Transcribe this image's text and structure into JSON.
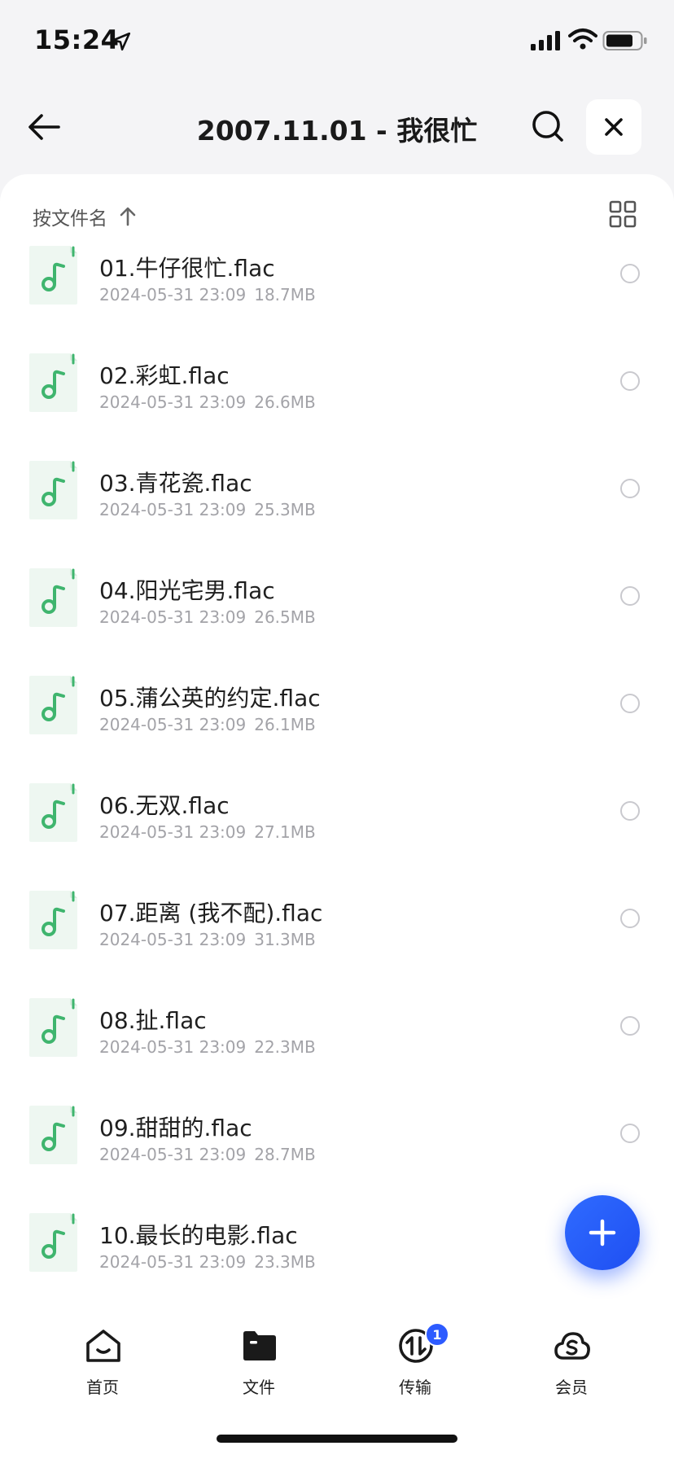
{
  "status_bar": {
    "time": "15:24",
    "icons": [
      "location-arrow-icon",
      "cellular-signal-icon",
      "wifi-icon",
      "battery-icon"
    ]
  },
  "header": {
    "title": "2007.11.01 - 我很忙",
    "back_icon": "arrow-left-icon",
    "search_icon": "search-icon",
    "close_icon": "close-icon"
  },
  "toolbar": {
    "sort_label": "按文件名",
    "sort_icon": "arrow-up-icon",
    "view_icon": "grid-view-icon"
  },
  "files": [
    {
      "name": "01.牛仔很忙.flac",
      "date": "2024-05-31 23:09",
      "size": "18.7MB"
    },
    {
      "name": "02.彩虹.flac",
      "date": "2024-05-31 23:09",
      "size": "26.6MB"
    },
    {
      "name": "03.青花瓷.flac",
      "date": "2024-05-31 23:09",
      "size": "25.3MB"
    },
    {
      "name": "04.阳光宅男.flac",
      "date": "2024-05-31 23:09",
      "size": "26.5MB"
    },
    {
      "name": "05.蒲公英的约定.flac",
      "date": "2024-05-31 23:09",
      "size": "26.1MB"
    },
    {
      "name": "06.无双.flac",
      "date": "2024-05-31 23:09",
      "size": "27.1MB"
    },
    {
      "name": "07.距离 (我不配).flac",
      "date": "2024-05-31 23:09",
      "size": "31.3MB"
    },
    {
      "name": "08.扯.flac",
      "date": "2024-05-31 23:09",
      "size": "22.3MB"
    },
    {
      "name": "09.甜甜的.flac",
      "date": "2024-05-31 23:09",
      "size": "28.7MB"
    },
    {
      "name": "10.最长的电影.flac",
      "date": "2024-05-31 23:09",
      "size": "23.3MB"
    }
  ],
  "fab": {
    "icon": "plus-icon"
  },
  "bottom_nav": {
    "items": [
      {
        "label": "首页",
        "icon": "home-icon"
      },
      {
        "label": "文件",
        "icon": "folder-icon"
      },
      {
        "label": "传输",
        "icon": "transfer-icon",
        "badge": "1"
      },
      {
        "label": "会员",
        "icon": "membership-cloud-icon"
      }
    ]
  },
  "colors": {
    "accent": "#2d5bff",
    "music_green": "#3fb56e",
    "background": "#f4f4f6",
    "meta_text": "#a3a3a8"
  }
}
